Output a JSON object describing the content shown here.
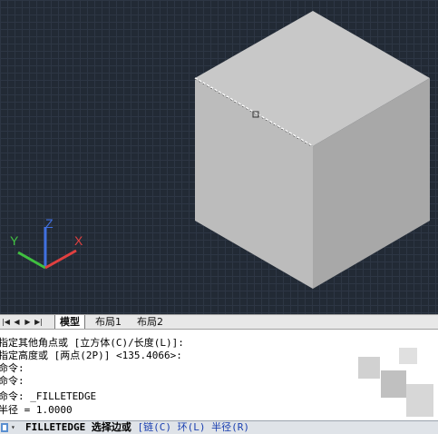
{
  "colors": {
    "viewport_bg": "#222a35",
    "cube_top": "#c8c8c8",
    "cube_left": "#bdbdbd",
    "cube_right": "#a7a7a7",
    "axis_x": "#e04040",
    "axis_y": "#40c040",
    "axis_z": "#4070e0",
    "option_blue": "#1a3fb0"
  },
  "ucs": {
    "x_label": "X",
    "y_label": "Y",
    "z_label": "Z"
  },
  "tabs": {
    "nav_icons": [
      "first-layout-icon",
      "prev-layout-icon",
      "next-layout-icon",
      "last-layout-icon"
    ],
    "items": [
      {
        "label": "模型",
        "active": true
      },
      {
        "label": "布局1",
        "active": false
      },
      {
        "label": "布局2",
        "active": false
      }
    ]
  },
  "command_history": [
    "指定其他角点或 [立方体(C)/长度(L)]:",
    "指定高度或 [两点(2P)] <135.4066>:",
    "命令:",
    "命令:",
    "命令: _FILLETEDGE",
    "半径 = 1.0000"
  ],
  "command_line": {
    "command": "FILLETEDGE",
    "prompt": "选择边或",
    "options": [
      "[链(C)",
      "环(L)",
      "半径(R)"
    ]
  }
}
